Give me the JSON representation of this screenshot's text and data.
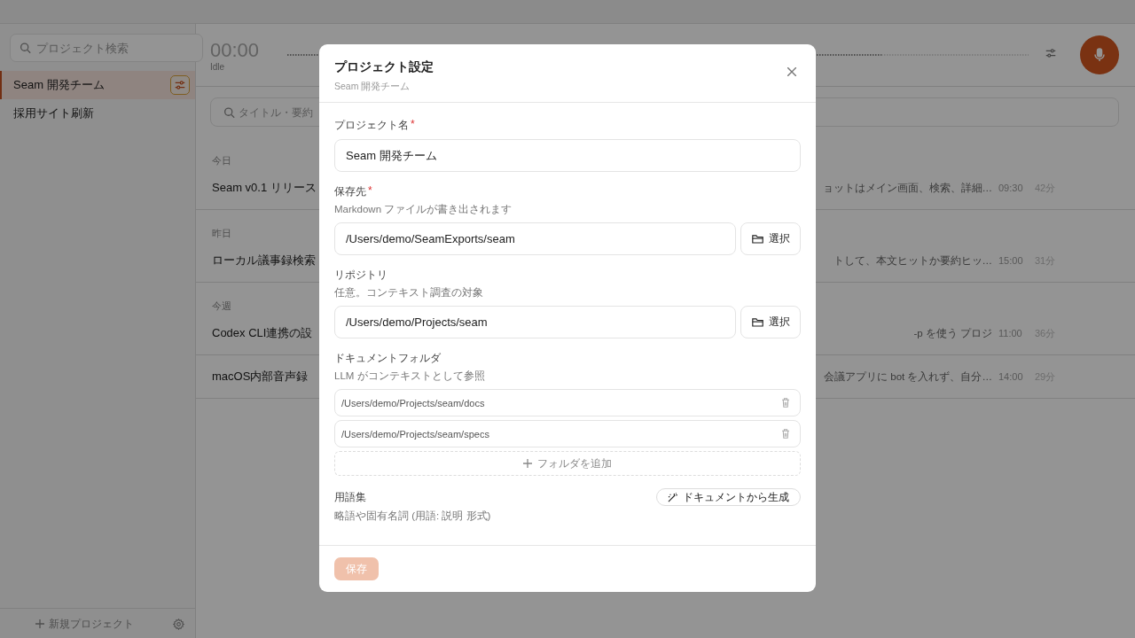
{
  "sidebar": {
    "search_placeholder": "プロジェクト検索",
    "projects": [
      {
        "name": "Seam 開発チーム",
        "selected": true
      },
      {
        "name": "採用サイト刷新",
        "selected": false
      }
    ],
    "new_project": "新規プロジェクト"
  },
  "recorder": {
    "time": "00:00",
    "status": "Idle"
  },
  "meetings": {
    "search_placeholder": "タイトル・要約",
    "groups": [
      {
        "label": "今日",
        "rows": [
          {
            "title": "Seam v0.1 リリース",
            "summary": "ョットはメイン画面、検索、詳細…",
            "time": "09:30",
            "duration": "42分"
          }
        ]
      },
      {
        "label": "昨日",
        "rows": [
          {
            "title": "ローカル議事録検索",
            "summary": "トして、本文ヒットか要約ヒッ…",
            "time": "15:00",
            "duration": "31分"
          }
        ]
      },
      {
        "label": "今週",
        "rows": [
          {
            "title": "Codex CLI連携の設",
            "summary": "-p を使う プロジ",
            "time": "11:00",
            "duration": "36分"
          },
          {
            "title": "macOS内部音声録",
            "summary": "会議アプリに bot を入れず、自分…",
            "time": "14:00",
            "duration": "29分"
          }
        ]
      }
    ]
  },
  "dialog": {
    "title": "プロジェクト設定",
    "subtitle": "Seam 開発チーム",
    "fields": [
      {
        "kind": "text",
        "label": "プロジェクト名",
        "required_mark": "*",
        "value": "Seam 開発チーム"
      },
      {
        "kind": "path",
        "label": "保存先",
        "required_mark": "*",
        "hint": "Markdown ファイルが書き出されます",
        "value": "/Users/demo/SeamExports/seam",
        "button": "選択"
      },
      {
        "kind": "path",
        "label": "リポジトリ",
        "hint": "任意。コンテキスト調査の対象",
        "value": "/Users/demo/Projects/seam",
        "button": "選択"
      },
      {
        "kind": "folders",
        "label": "ドキュメントフォルダ",
        "hint": "LLM がコンテキストとして参照",
        "folders": [
          "/Users/demo/Projects/seam/docs",
          "/Users/demo/Projects/seam/specs"
        ],
        "add_label": "フォルダを追加"
      },
      {
        "kind": "glossary",
        "label": "用語集",
        "hint": "略語や固有名詞 (用語: 説明 形式)",
        "action": "ドキュメントから生成"
      }
    ],
    "save": {
      "label": "保存",
      "disabled": true
    }
  }
}
